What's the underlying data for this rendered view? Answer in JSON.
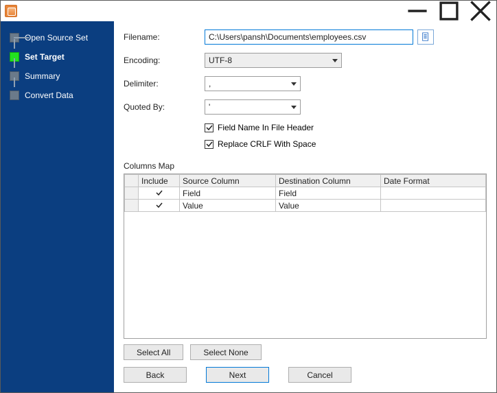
{
  "sidebar": {
    "steps": [
      {
        "label": "Open Source Set"
      },
      {
        "label": "Set Target"
      },
      {
        "label": "Summary"
      },
      {
        "label": "Convert Data"
      }
    ]
  },
  "form": {
    "filename_label": "Filename:",
    "filename_value": "C:\\Users\\pansh\\Documents\\employees.csv",
    "encoding_label": "Encoding:",
    "encoding_value": "UTF-8",
    "delimiter_label": "Delimiter:",
    "delimiter_value": ",",
    "quoted_label": "Quoted By:",
    "quoted_value": "'",
    "cb_header_label": "Field Name In File Header",
    "cb_crlf_label": "Replace CRLF With Space"
  },
  "columns_map": {
    "title": "Columns Map",
    "headers": {
      "include": "Include",
      "source": "Source Column",
      "dest": "Destination Column",
      "fmt": "Date Format"
    },
    "rows": [
      {
        "include": true,
        "source": "Field",
        "dest": "Field",
        "fmt": ""
      },
      {
        "include": true,
        "source": "Value",
        "dest": "Value",
        "fmt": ""
      }
    ]
  },
  "buttons": {
    "select_all": "Select All",
    "select_none": "Select None",
    "back": "Back",
    "next": "Next",
    "cancel": "Cancel"
  }
}
